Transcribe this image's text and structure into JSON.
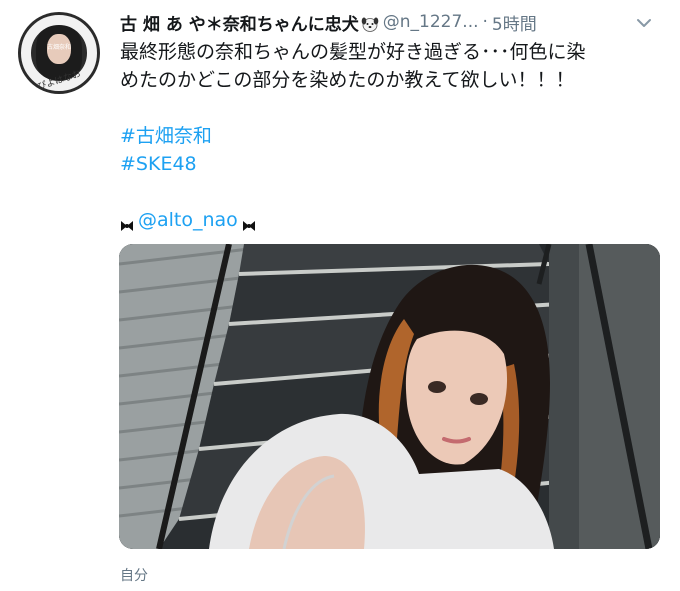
{
  "tweet": {
    "author_name": "古 畑 あ や＊奈和ちゃんに忠犬",
    "author_emoji_icon": "dog-face-icon",
    "handle": "@n_1227...",
    "separator": "·",
    "time": "5時間",
    "menu_icon": "chevron-down-icon",
    "avatar": {
      "top_text": "古畑奈和",
      "bottom_text": "ぴよはなお"
    },
    "text_lines": [
      "最終形態の奈和ちゃんの髪型が好き過ぎる･･･何色に染",
      "めたのかどこの部分を染めたのか教えて欲しい！！！"
    ],
    "hashtags": [
      "#古畑奈和",
      "#SKE48"
    ],
    "mention": "@alto_nao",
    "mention_decoration_icon": "ribbon-icon",
    "photo_description_icon": "photo-icon",
    "footer": "自分"
  }
}
